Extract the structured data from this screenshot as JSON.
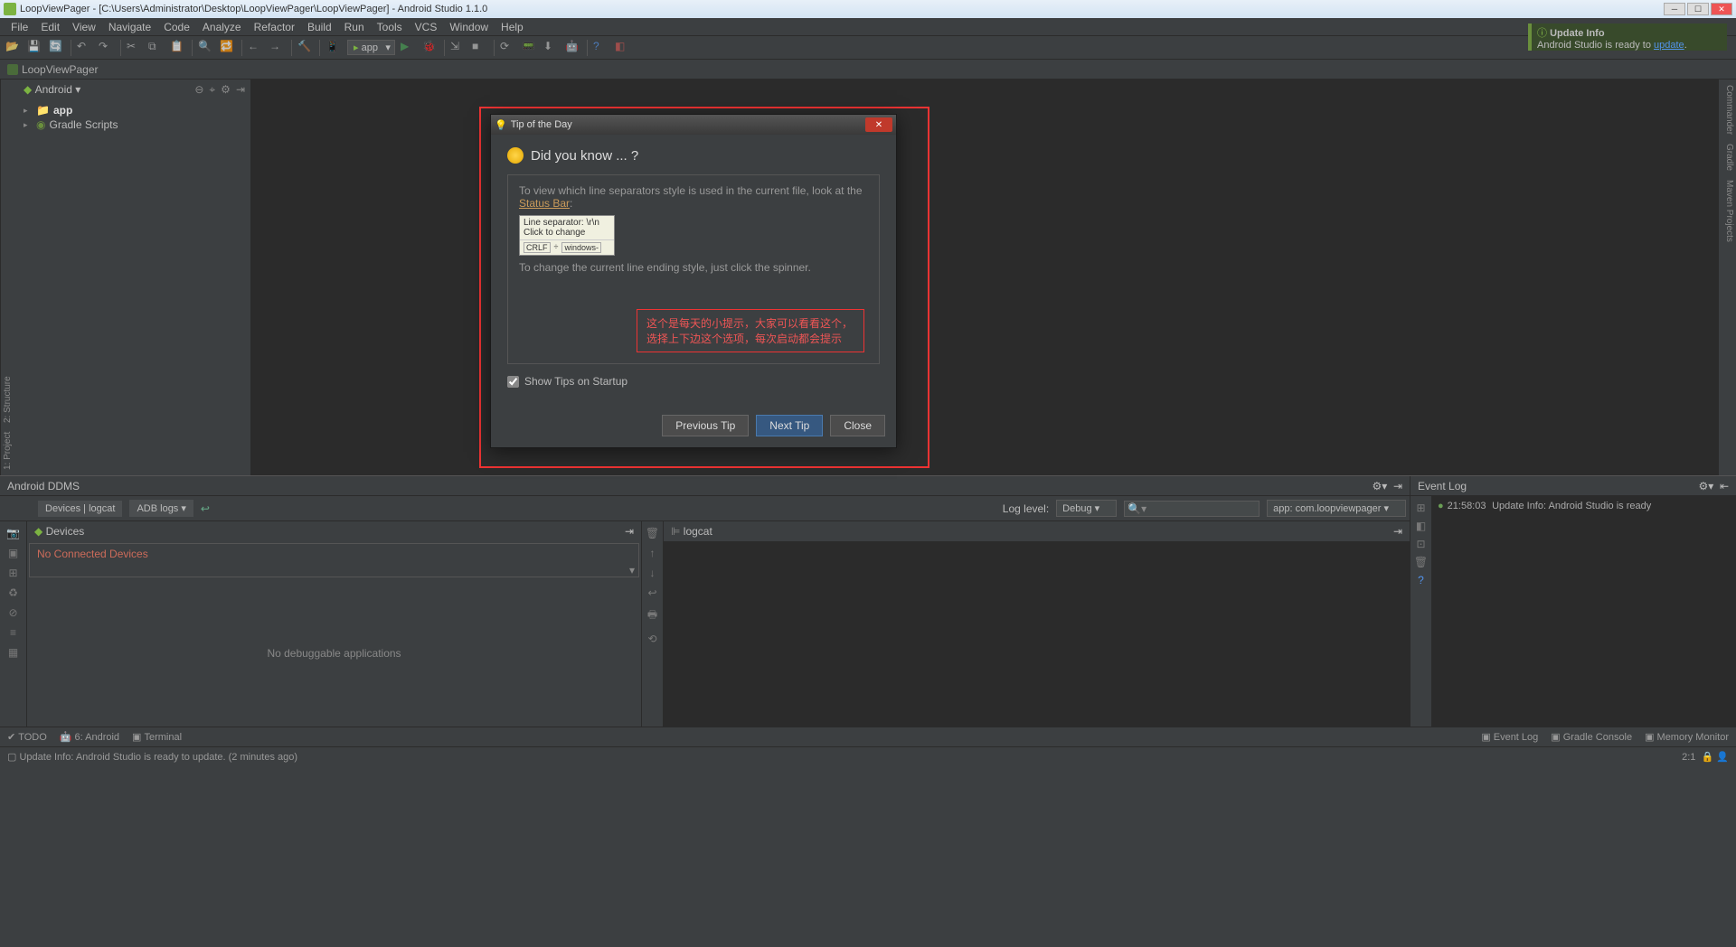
{
  "titlebar": {
    "text": "LoopViewPager - [C:\\Users\\Administrator\\Desktop\\LoopViewPager\\LoopViewPager] - Android Studio 1.1.0"
  },
  "menubar": [
    "File",
    "Edit",
    "View",
    "Navigate",
    "Code",
    "Analyze",
    "Refactor",
    "Build",
    "Run",
    "Tools",
    "VCS",
    "Window",
    "Help"
  ],
  "toolbar": {
    "app_combo": "app"
  },
  "update_box": {
    "title": "Update Info",
    "text": "Android Studio is ready to ",
    "link": "update"
  },
  "breadcrumb": "LoopViewPager",
  "project": {
    "header": "Android",
    "tree": [
      {
        "label": "app",
        "bold": true,
        "icon": "folder"
      },
      {
        "label": "Gradle Scripts",
        "icon": "gradle"
      }
    ]
  },
  "left_gutter": [
    "1: Project",
    "2: Structure"
  ],
  "right_gutter": [
    "Commander",
    "Gradle",
    "Maven Projects"
  ],
  "ddms": {
    "title": "Android DDMS",
    "tabs": {
      "devices": "Devices | logcat",
      "adb": "ADB logs"
    },
    "loglevel_label": "Log level:",
    "loglevel": "Debug",
    "search_placeholder": "",
    "app_filter": "app: com.loopviewpager",
    "devices_label": "Devices",
    "no_connected": "No Connected Devices",
    "no_debug": "No debuggable applications",
    "logcat_label": "logcat"
  },
  "eventlog": {
    "title": "Event Log",
    "entry_time": "21:58:03",
    "entry_text": "Update Info: Android Studio is ready"
  },
  "toolwin": {
    "todo": "TODO",
    "android": "6: Android",
    "terminal": "Terminal",
    "right": [
      "Event Log",
      "Gradle Console",
      "Memory Monitor"
    ]
  },
  "statusbar": {
    "text": "Update Info: Android Studio is ready to update. (2 minutes ago)",
    "pos": "2:1"
  },
  "dialog": {
    "title": "Tip of the Day",
    "heading": "Did you know ... ?",
    "para1": "To view which line separators style is used in the current file, look at the ",
    "status_link": "Status Bar",
    "tooltip_line1": "Line separator: \\r\\n",
    "tooltip_line2": "Click to change",
    "tooltip_crlf": "CRLF",
    "tooltip_win": "windows-",
    "para2": "To change the current line ending style, just click the spinner.",
    "red_note_line1": "这个是每天的小提示，大家可以看看这个，",
    "red_note_line2": "选择上下边这个选项，每次启动都会提示",
    "checkbox": "Show Tips on Startup",
    "btn_prev": "Previous Tip",
    "btn_next": "Next Tip",
    "btn_close": "Close"
  }
}
